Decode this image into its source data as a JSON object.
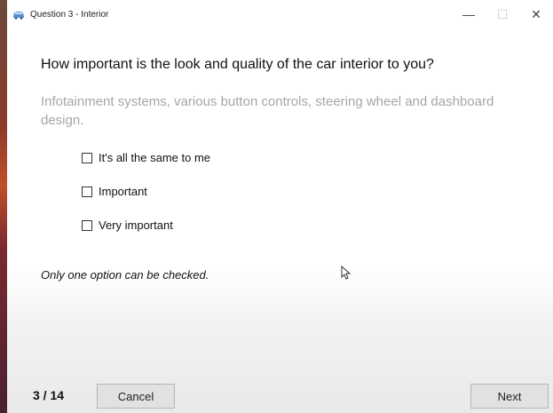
{
  "window": {
    "title": "Question 3 - Interior",
    "icon": "car-icon",
    "controls": {
      "minimize": "—",
      "maximize": "☐",
      "close": "✕"
    }
  },
  "question": {
    "text": "How important is the look and quality of the car interior to you?",
    "description": "Infotainment systems, various button controls, steering wheel and dashboard design."
  },
  "options": [
    {
      "label": "It's all the same to me",
      "checked": false
    },
    {
      "label": "Important",
      "checked": false
    },
    {
      "label": "Very important",
      "checked": false
    }
  ],
  "note": "Only one option can be checked.",
  "footer": {
    "progress": "3 / 14",
    "cancel_label": "Cancel",
    "next_label": "Next"
  },
  "colors": {
    "description_text": "#a6a6a6",
    "button_face": "#e1e1e1",
    "app_icon": "#5b8fd6"
  }
}
